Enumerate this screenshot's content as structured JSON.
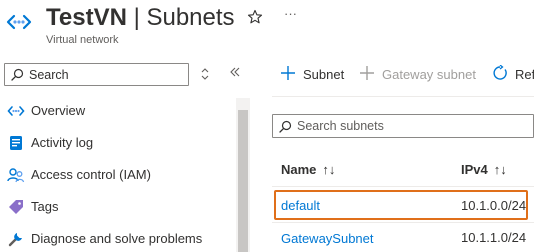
{
  "header": {
    "title": "TestVN",
    "title_suffix": "| Subnets",
    "subtitle": "Virtual network",
    "more_label": "···"
  },
  "sidebar": {
    "search_placeholder": "Search",
    "items": [
      {
        "label": "Overview",
        "icon": "overview-icon"
      },
      {
        "label": "Activity log",
        "icon": "activity-log-icon"
      },
      {
        "label": "Access control (IAM)",
        "icon": "iam-icon"
      },
      {
        "label": "Tags",
        "icon": "tag-icon"
      },
      {
        "label": "Diagnose and solve problems",
        "icon": "wrench-icon"
      }
    ]
  },
  "toolbar": {
    "add_subnet": "Subnet",
    "add_gateway_subnet": "Gateway subnet",
    "refresh": "Ref"
  },
  "search_subnets": {
    "placeholder": "Search subnets"
  },
  "table": {
    "columns": [
      "Name",
      "IPv4"
    ],
    "sort_glyph": "↑↓",
    "rows": [
      {
        "name": "default",
        "ipv4": "10.1.0.0/24",
        "highlighted": true
      },
      {
        "name": "GatewaySubnet",
        "ipv4": "10.1.1.0/24",
        "highlighted": false
      }
    ]
  },
  "colors": {
    "accent": "#0078d4",
    "highlight_border": "#e06f1a",
    "text": "#323130",
    "muted": "#605e5c"
  }
}
